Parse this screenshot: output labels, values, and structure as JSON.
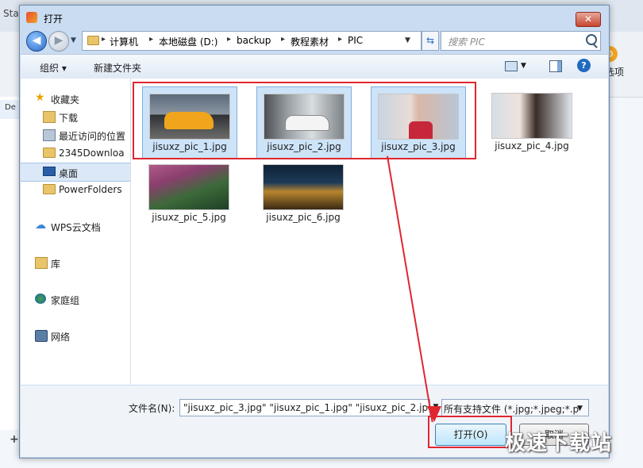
{
  "background_app": {
    "title_fragment": "Sta",
    "left_label": "De",
    "options_label": "选项",
    "toolbar_fragment": "还",
    "plus": "+"
  },
  "dialog": {
    "title": "打开",
    "close_symbol": "✕"
  },
  "nav": {
    "breadcrumbs": [
      "计算机",
      "本地磁盘 (D:)",
      "backup",
      "教程素材",
      "PIC"
    ],
    "search_placeholder": "搜索 PIC"
  },
  "toolbar": {
    "organize_label": "组织 ▾",
    "new_folder_label": "新建文件夹"
  },
  "sidebar": {
    "items": [
      {
        "label": "收藏夹",
        "icon": "star-icon"
      },
      {
        "label": "下载",
        "icon": "download-folder-icon"
      },
      {
        "label": "最近访问的位置",
        "icon": "recent-places-icon"
      },
      {
        "label": "2345Downloa",
        "icon": "folder-icon"
      },
      {
        "label": "桌面",
        "icon": "desktop-icon"
      },
      {
        "label": "PowerFolders",
        "icon": "folder-icon"
      },
      {
        "label": "WPS云文档",
        "icon": "cloud-icon"
      },
      {
        "label": "库",
        "icon": "library-icon"
      },
      {
        "label": "家庭组",
        "icon": "homegroup-icon"
      },
      {
        "label": "网络",
        "icon": "network-icon"
      }
    ]
  },
  "files": [
    {
      "name": "jisuxz_pic_1.jpg",
      "selected": true
    },
    {
      "name": "jisuxz_pic_2.jpg",
      "selected": true
    },
    {
      "name": "jisuxz_pic_3.jpg",
      "selected": true
    },
    {
      "name": "jisuxz_pic_4.jpg",
      "selected": false
    },
    {
      "name": "jisuxz_pic_5.jpg",
      "selected": false
    },
    {
      "name": "jisuxz_pic_6.jpg",
      "selected": false
    }
  ],
  "bottom": {
    "filename_label": "文件名(N):",
    "filename_value": "\"jisuxz_pic_3.jpg\" \"jisuxz_pic_1.jpg\" \"jisuxz_pic_2.jpg",
    "filter_value": "所有支持文件 (*.jpg;*.jpeg;*.p",
    "open_button": "打开(O)",
    "cancel_button": "取消"
  },
  "watermark": "极速下载站",
  "colors": {
    "annotation": "#e0262f",
    "selection": "#cde3f8",
    "dialog_frame": "#c9dcf1"
  }
}
